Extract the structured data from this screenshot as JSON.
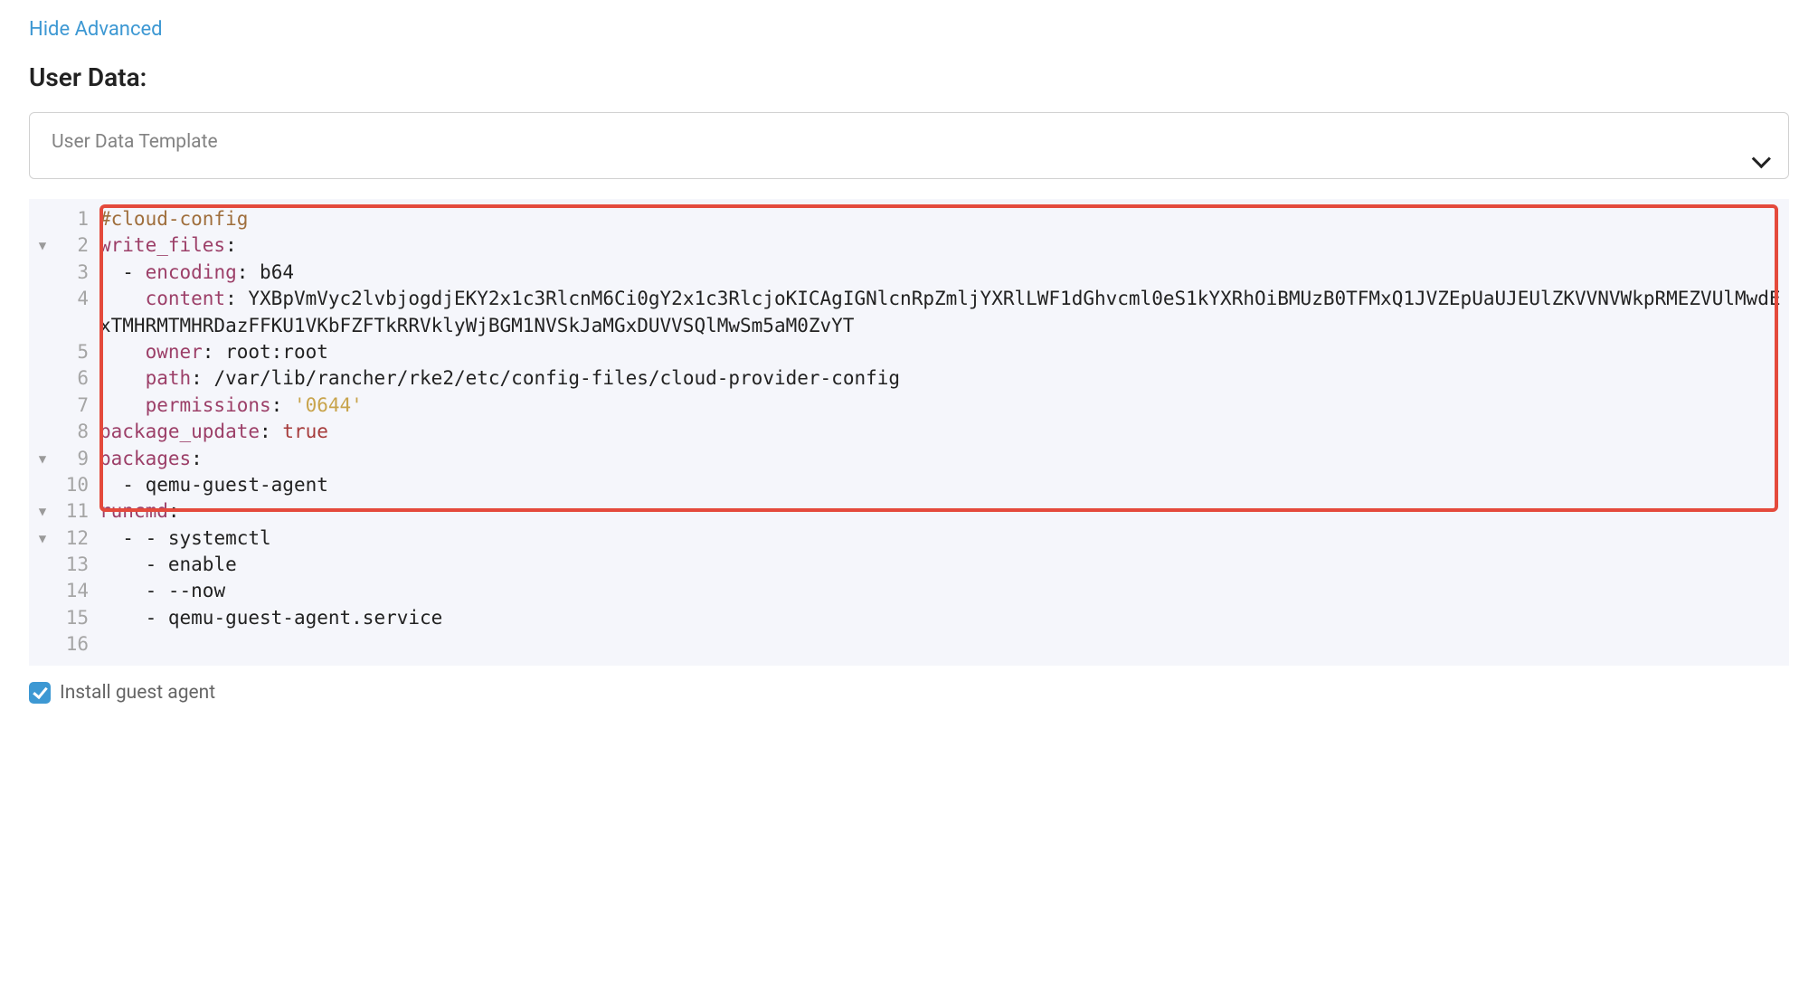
{
  "hide_advanced_label": "Hide Advanced",
  "section_heading": "User Data:",
  "select": {
    "label": "User Data Template"
  },
  "fold_marker": "▼",
  "code_lines": [
    {
      "n": 1,
      "fold": "",
      "segments": [
        {
          "cls": "tok-comment",
          "t": "#cloud-config"
        }
      ]
    },
    {
      "n": 2,
      "fold": "▼",
      "segments": [
        {
          "cls": "tok-key",
          "t": "write_files"
        },
        {
          "cls": "tok-punct",
          "t": ":"
        }
      ]
    },
    {
      "n": 3,
      "fold": "",
      "segments": [
        {
          "cls": "",
          "t": "  - "
        },
        {
          "cls": "tok-key",
          "t": "encoding"
        },
        {
          "cls": "tok-punct",
          "t": ": "
        },
        {
          "cls": "tok-str",
          "t": "b64"
        }
      ]
    },
    {
      "n": 4,
      "fold": "",
      "segments": [
        {
          "cls": "",
          "t": "    "
        },
        {
          "cls": "tok-key",
          "t": "content"
        },
        {
          "cls": "tok-punct",
          "t": ": "
        },
        {
          "cls": "tok-str",
          "t": "YXBpVmVyc2lvbjogdjEKY2x1c3RlcnM6Ci0gY2x1c3RlcjoKICAgIGNlcnRpZmljYXRlLWF1dGhvcml0eS1kYXRhOiBMUzB0TFMxQ1JVZEpUaUJEUlZKVVNVWkpRMEZVUlMwdExTMHRMTMHRDazFFKU1VKbFZFTkRRVklyWjBGM1NVSkJaMGxDUVVSQlMwSm5aM0ZvYT"
        }
      ]
    },
    {
      "n": 5,
      "fold": "",
      "segments": [
        {
          "cls": "",
          "t": "    "
        },
        {
          "cls": "tok-key",
          "t": "owner"
        },
        {
          "cls": "tok-punct",
          "t": ": "
        },
        {
          "cls": "tok-str",
          "t": "root:root"
        }
      ]
    },
    {
      "n": 6,
      "fold": "",
      "segments": [
        {
          "cls": "",
          "t": "    "
        },
        {
          "cls": "tok-key",
          "t": "path"
        },
        {
          "cls": "tok-punct",
          "t": ": "
        },
        {
          "cls": "tok-str",
          "t": "/var/lib/rancher/rke2/etc/config-files/cloud-provider-config"
        }
      ]
    },
    {
      "n": 7,
      "fold": "",
      "segments": [
        {
          "cls": "",
          "t": "    "
        },
        {
          "cls": "tok-key",
          "t": "permissions"
        },
        {
          "cls": "tok-punct",
          "t": ": "
        },
        {
          "cls": "tok-quoted",
          "t": "'0644'"
        }
      ]
    },
    {
      "n": 8,
      "fold": "",
      "segments": [
        {
          "cls": "tok-key",
          "t": "package_update"
        },
        {
          "cls": "tok-punct",
          "t": ": "
        },
        {
          "cls": "tok-bool",
          "t": "true"
        }
      ]
    },
    {
      "n": 9,
      "fold": "▼",
      "segments": [
        {
          "cls": "tok-key",
          "t": "packages"
        },
        {
          "cls": "tok-punct",
          "t": ":"
        }
      ]
    },
    {
      "n": 10,
      "fold": "",
      "segments": [
        {
          "cls": "",
          "t": "  - "
        },
        {
          "cls": "tok-str",
          "t": "qemu-guest-agent"
        }
      ]
    },
    {
      "n": 11,
      "fold": "▼",
      "segments": [
        {
          "cls": "tok-key",
          "t": "runcmd"
        },
        {
          "cls": "tok-punct",
          "t": ":"
        }
      ]
    },
    {
      "n": 12,
      "fold": "▼",
      "segments": [
        {
          "cls": "",
          "t": "  - - "
        },
        {
          "cls": "tok-str",
          "t": "systemctl"
        }
      ]
    },
    {
      "n": 13,
      "fold": "",
      "segments": [
        {
          "cls": "",
          "t": "    - "
        },
        {
          "cls": "tok-str",
          "t": "enable"
        }
      ]
    },
    {
      "n": 14,
      "fold": "",
      "segments": [
        {
          "cls": "",
          "t": "    - "
        },
        {
          "cls": "tok-str",
          "t": "--now"
        }
      ]
    },
    {
      "n": 15,
      "fold": "",
      "segments": [
        {
          "cls": "",
          "t": "    - "
        },
        {
          "cls": "tok-str",
          "t": "qemu-guest-agent.service"
        }
      ]
    },
    {
      "n": 16,
      "fold": "",
      "segments": []
    }
  ],
  "install_guest_agent_label": "Install guest agent",
  "install_guest_agent_checked": true
}
